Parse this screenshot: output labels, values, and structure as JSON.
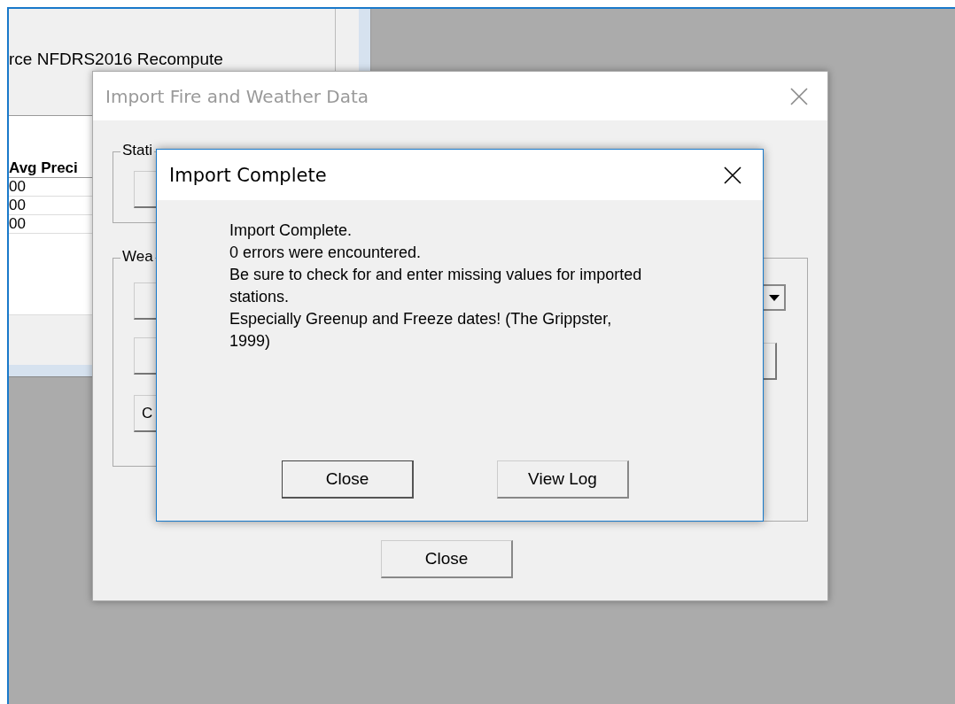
{
  "background_window": {
    "header_text": "rce NFDRS2016 Recompute",
    "table": {
      "columns": [
        "Avg Preci"
      ],
      "rows": [
        [
          "00"
        ],
        [
          "00"
        ],
        [
          "00"
        ]
      ]
    }
  },
  "import_dialog": {
    "title": "Import Fire and Weather Data",
    "groups": [
      {
        "label": "Stati"
      },
      {
        "label": "Wea"
      }
    ],
    "partial_button_label": "C",
    "close_button": "Close"
  },
  "message_dialog": {
    "title": "Import Complete",
    "message_lines": [
      "Import Complete.",
      "0 errors were encountered.",
      "Be sure to check for and enter missing values for imported stations.",
      "Especially Greenup and Freeze dates! (The Grippster, 1999)"
    ],
    "buttons": [
      {
        "label": "Close",
        "default": true
      },
      {
        "label": "View Log",
        "default": false
      }
    ]
  }
}
